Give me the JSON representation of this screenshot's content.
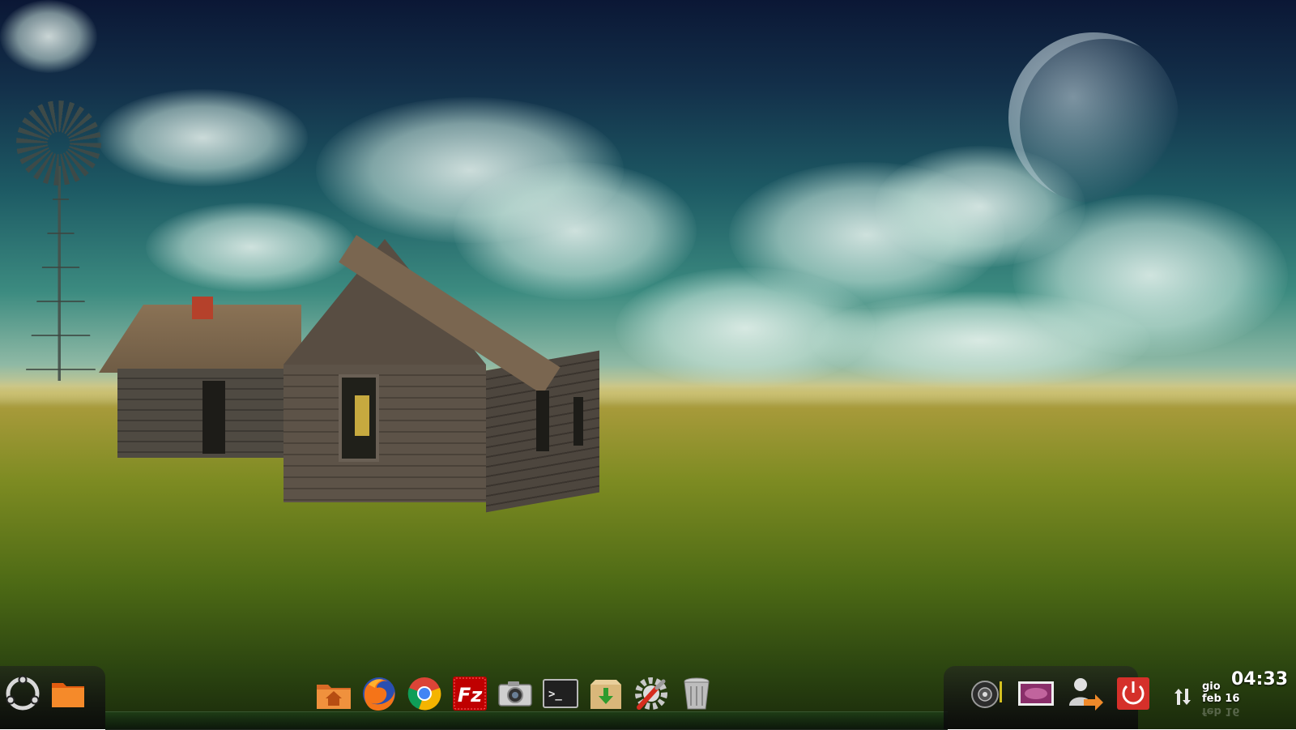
{
  "desktop": {
    "wallpaper": "farmhouse in wheat field with windmill and moon",
    "colors": {
      "sky_top": "#0b1735",
      "sky_mid": "#1d5a64",
      "field": "#7d8b22",
      "taskbar": "#101010"
    }
  },
  "dock_left": {
    "items": [
      {
        "icon": "ubuntu-menu-icon",
        "label": ""
      },
      {
        "icon": "folder-icon",
        "label": ""
      }
    ]
  },
  "dock_center": {
    "items": [
      {
        "icon": "home-folder-icon"
      },
      {
        "icon": "firefox-icon"
      },
      {
        "icon": "chrome-icon"
      },
      {
        "icon": "filezilla-icon",
        "text": "Fz"
      },
      {
        "icon": "screenshot-camera-icon"
      },
      {
        "icon": "terminal-icon",
        "text": ">_"
      },
      {
        "icon": "package-installer-icon"
      },
      {
        "icon": "system-settings-icon"
      },
      {
        "icon": "trash-icon"
      }
    ]
  },
  "dock_right": {
    "items": [
      {
        "icon": "speaker-icon"
      },
      {
        "icon": "display-icon"
      },
      {
        "icon": "user-logout-icon"
      },
      {
        "icon": "power-icon"
      }
    ]
  },
  "tray": {
    "network_icon": "network-updown-icon",
    "day": "gio",
    "date": "feb 16",
    "time": "04:33"
  }
}
